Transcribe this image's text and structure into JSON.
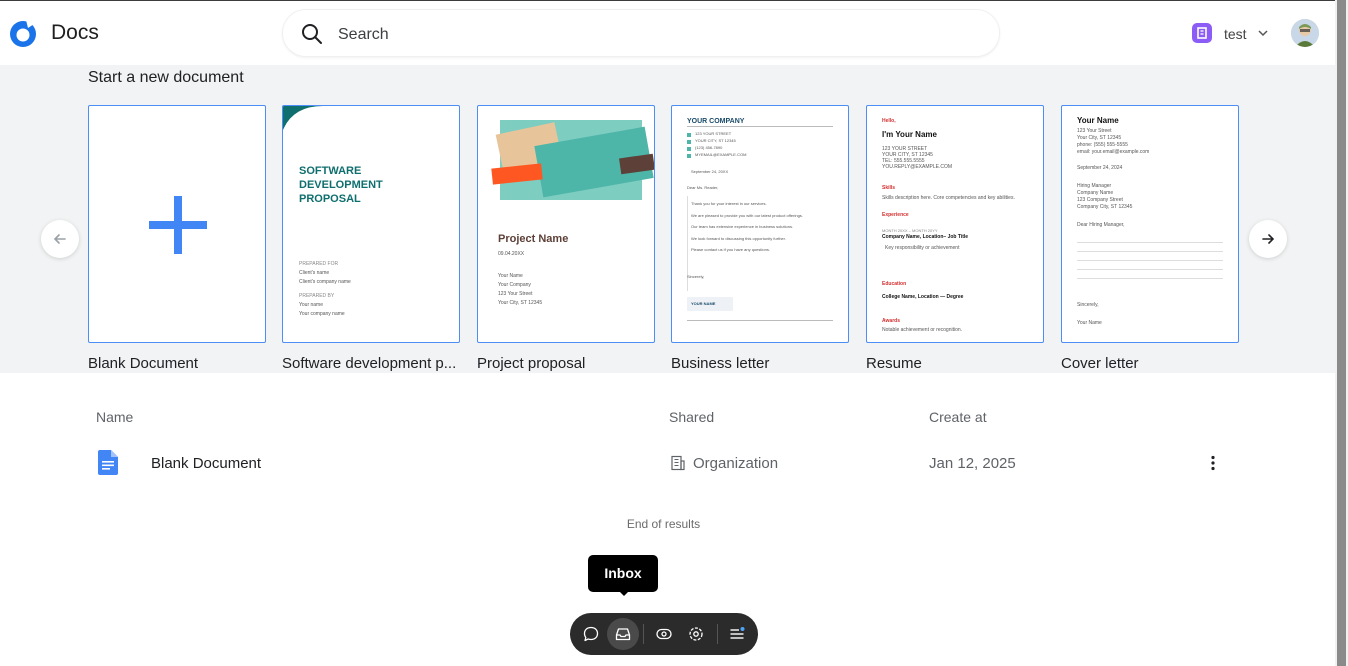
{
  "app": {
    "title": "Docs"
  },
  "search": {
    "placeholder": "Search"
  },
  "org": {
    "name": "test",
    "badge_color": "#8b5cf6"
  },
  "templates": {
    "heading": "Start a new document",
    "cards": [
      {
        "label": "Blank Document"
      },
      {
        "label": "Software development p...",
        "thumb_lines": [
          "SOFTWARE",
          "DEVELOPMENT",
          "PROPOSAL",
          "PREPARED FOR",
          "Client's name",
          "Client's company name",
          "PREPARED BY",
          "Your name",
          "Your company name"
        ]
      },
      {
        "label": "Project proposal",
        "thumb_lines": [
          "Project Name",
          "09.04.20XX",
          "Your Name",
          "Your Company",
          "123 Your Street",
          "Your City, ST 12345"
        ]
      },
      {
        "label": "Business letter",
        "thumb_lines": [
          "YOUR COMPANY",
          "123 YOUR STREET",
          "YOUR CITY, ST 12345",
          "(123) 456-7890",
          "MYEMAIL@EXAMPLE.COM",
          "September 24, 20XX",
          "Dear Ms. Reader,",
          "Thank you for your interest in our services.",
          "We are pleased to provide you with our latest product offerings.",
          "Our team has extensive experience in business solutions.",
          "We look forward to discussing this opportunity further.",
          "Please contact us if you have any questions.",
          "Sincerely,",
          "YOUR NAME"
        ]
      },
      {
        "label": "Resume",
        "thumb_lines": [
          "Hello,",
          "I'm Your Name",
          "123 YOUR STREET",
          "YOUR CITY, ST 12345",
          "TEL: 555.555.5555",
          "YOU.REPLY@EXAMPLE.COM",
          "Skills",
          "Skills description here. Core competencies and key abilities.",
          "Experience",
          "MONTH 20XX – MONTH 20YY",
          "Company Name, Location– Job Title",
          "Key responsibility or achievement",
          "Education",
          "College Name, Location — Degree",
          "Awards",
          "Notable achievement or recognition."
        ]
      },
      {
        "label": "Cover letter",
        "thumb_lines": [
          "Your Name",
          "123 Your Street",
          "Your City, ST 12345",
          "phone: (555) 555-5555",
          "email: your.email@example.com",
          "September 24, 2024",
          "Hiring Manager",
          "Company Name",
          "123 Company Street",
          "Company City, ST 12345",
          "Dear Hiring Manager,",
          "Sincerely,",
          "Your Name"
        ]
      }
    ]
  },
  "list": {
    "columns": {
      "name": "Name",
      "shared": "Shared",
      "created": "Create at"
    },
    "rows": [
      {
        "name": "Blank Document",
        "shared": "Organization",
        "created": "Jan 12, 2025"
      }
    ],
    "end_text": "End of results"
  },
  "tooltip": {
    "text": "Inbox"
  },
  "toolbar": {
    "buttons": [
      "comment-icon",
      "inbox-icon",
      "eye-toggle-icon",
      "settings-eye-icon",
      "menu-list-icon"
    ]
  },
  "colors": {
    "accent": "#4285f4",
    "band_bg": "#f1f3f4"
  }
}
